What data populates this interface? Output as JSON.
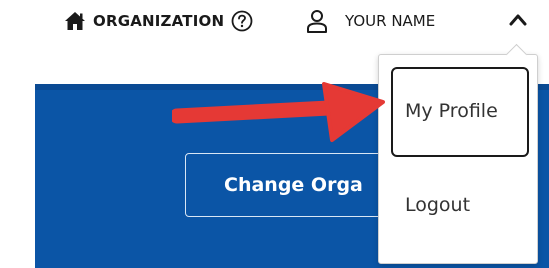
{
  "header": {
    "org_label": "ORGANIZATION",
    "user_label": "YOUR NAME",
    "icons": {
      "org": "home-icon",
      "help": "help-circle-icon",
      "user": "user-icon",
      "chevron": "chevron-up-icon"
    }
  },
  "main": {
    "change_org_label": "Change Orga"
  },
  "dropdown": {
    "items": [
      {
        "label": "My Profile"
      },
      {
        "label": "Logout"
      }
    ]
  },
  "colors": {
    "panel_blue": "#0b55a6",
    "arrow_red": "#e53935",
    "text_dark": "#1a1a1a"
  }
}
